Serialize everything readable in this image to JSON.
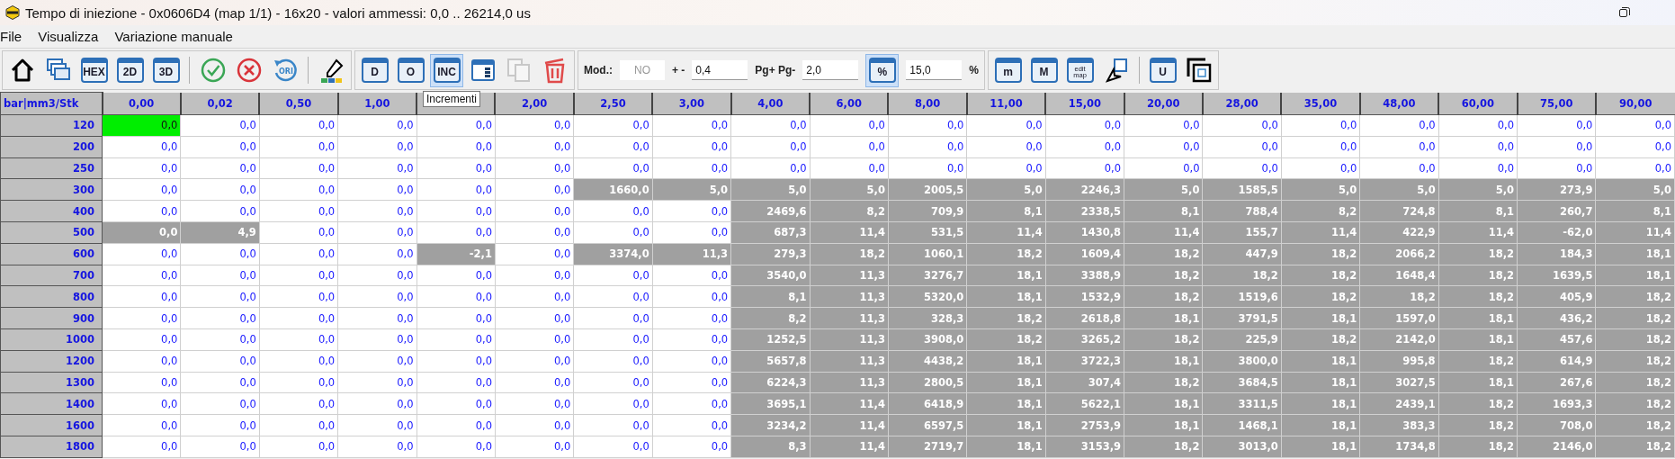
{
  "window": {
    "title": "Tempo di iniezione - 0x0606D4 (map 1/1) - 16x20 - valori ammessi: 0,0 .. 26214,0 us"
  },
  "menu": [
    {
      "label": "File"
    },
    {
      "label": "Visualizza"
    },
    {
      "label": "Variazione manuale"
    }
  ],
  "toolbar": [
    [
      {
        "kind": "home",
        "selected": false,
        "disabled": false
      },
      {
        "kind": "windows",
        "selected": false,
        "disabled": false
      },
      {
        "kind": "labeled",
        "label": "HEX",
        "selected": false,
        "disabled": false
      },
      {
        "kind": "labeled",
        "label": "2D",
        "selected": false,
        "disabled": false
      },
      {
        "kind": "labeled",
        "label": "3D",
        "selected": false,
        "disabled": false
      },
      {
        "kind": "sep"
      },
      {
        "kind": "check",
        "selected": false,
        "disabled": false
      },
      {
        "kind": "cancel",
        "selected": false,
        "disabled": false
      },
      {
        "kind": "ori",
        "label": "ORI",
        "selected": false,
        "disabled": false
      },
      {
        "kind": "sep"
      },
      {
        "kind": "picker",
        "selected": false,
        "disabled": false
      }
    ],
    [
      {
        "kind": "labeled",
        "label": "D",
        "selected": false,
        "disabled": false
      },
      {
        "kind": "labeled",
        "label": "O",
        "selected": false,
        "disabled": false
      },
      {
        "kind": "labeled",
        "label": "INC",
        "selected": true,
        "disabled": false
      },
      {
        "kind": "panel",
        "selected": false,
        "disabled": false
      },
      {
        "kind": "copy",
        "selected": false,
        "disabled": true
      },
      {
        "kind": "trash",
        "selected": false,
        "disabled": false
      }
    ],
    [
      {
        "kind": "text",
        "label": "Mod.:"
      },
      {
        "kind": "field",
        "value": "NO",
        "disabled": true
      },
      {
        "kind": "text",
        "label": "+ -"
      },
      {
        "kind": "field",
        "value": "0,4",
        "disabled": false
      },
      {
        "kind": "text",
        "label": "Pg+ Pg-"
      },
      {
        "kind": "field",
        "value": "2,0",
        "disabled": false
      },
      {
        "kind": "labeled",
        "label": "%",
        "selected": true,
        "disabled": false
      },
      {
        "kind": "field",
        "value": "15,0",
        "disabled": false
      },
      {
        "kind": "text",
        "label": "%"
      }
    ],
    [
      {
        "kind": "labeled",
        "label": "m",
        "selected": false,
        "disabled": false
      },
      {
        "kind": "labeled",
        "label": "M",
        "selected": false,
        "disabled": false
      },
      {
        "kind": "labeled",
        "label": "edit map",
        "selected": false,
        "disabled": false
      },
      {
        "kind": "cursor",
        "selected": false,
        "disabled": false
      },
      {
        "kind": "sep"
      },
      {
        "kind": "labeled",
        "label": "U",
        "selected": false,
        "disabled": false
      },
      {
        "kind": "winframe",
        "selected": false,
        "disabled": false
      }
    ]
  ],
  "tooltip": {
    "text": "Incrementi"
  },
  "table": {
    "corner": "bar|mm3/Stk",
    "columns": [
      {
        "label": "0,00"
      },
      {
        "label": "0,02"
      },
      {
        "label": "0,50"
      },
      {
        "label": "1,00"
      },
      {},
      {
        "label": "2,00"
      },
      {
        "label": "2,50"
      },
      {
        "label": "3,00"
      },
      {
        "label": "4,00"
      },
      {
        "label": "6,00"
      },
      {
        "label": "8,00"
      },
      {
        "label": "11,00"
      },
      {
        "label": "15,00"
      },
      {
        "label": "20,00"
      },
      {
        "label": "28,00"
      },
      {
        "label": "35,00"
      },
      {
        "label": "48,00"
      },
      {
        "label": "60,00"
      },
      {
        "label": "75,00"
      },
      {
        "label": "90,00"
      }
    ],
    "rows": [
      {
        "label": "120",
        "cells": [
          {
            "value": "0,0",
            "selected": false,
            "current": true
          },
          {
            "value": "0,0",
            "selected": false
          },
          {
            "value": "0,0",
            "selected": false
          },
          {
            "value": "0,0",
            "selected": false
          },
          {
            "value": "0,0",
            "selected": false
          },
          {
            "value": "0,0",
            "selected": false
          },
          {
            "value": "0,0",
            "selected": false
          },
          {
            "value": "0,0",
            "selected": false
          },
          {
            "value": "0,0",
            "selected": false
          },
          {
            "value": "0,0",
            "selected": false
          },
          {
            "value": "0,0",
            "selected": false
          },
          {
            "value": "0,0",
            "selected": false
          },
          {
            "value": "0,0",
            "selected": false
          },
          {
            "value": "0,0",
            "selected": false
          },
          {
            "value": "0,0",
            "selected": false
          },
          {
            "value": "0,0",
            "selected": false
          },
          {
            "value": "0,0",
            "selected": false
          },
          {
            "value": "0,0",
            "selected": false
          },
          {
            "value": "0,0",
            "selected": false
          },
          {
            "value": "0,0",
            "selected": false
          }
        ]
      },
      {
        "label": "200",
        "cells": [
          {
            "value": "0,0",
            "selected": false
          },
          {
            "value": "0,0",
            "selected": false
          },
          {
            "value": "0,0",
            "selected": false
          },
          {
            "value": "0,0",
            "selected": false
          },
          {
            "value": "0,0",
            "selected": false
          },
          {
            "value": "0,0",
            "selected": false
          },
          {
            "value": "0,0",
            "selected": false
          },
          {
            "value": "0,0",
            "selected": false
          },
          {
            "value": "0,0",
            "selected": false
          },
          {
            "value": "0,0",
            "selected": false
          },
          {
            "value": "0,0",
            "selected": false
          },
          {
            "value": "0,0",
            "selected": false
          },
          {
            "value": "0,0",
            "selected": false
          },
          {
            "value": "0,0",
            "selected": false
          },
          {
            "value": "0,0",
            "selected": false
          },
          {
            "value": "0,0",
            "selected": false
          },
          {
            "value": "0,0",
            "selected": false
          },
          {
            "value": "0,0",
            "selected": false
          },
          {
            "value": "0,0",
            "selected": false
          },
          {
            "value": "0,0",
            "selected": false
          }
        ]
      },
      {
        "label": "250",
        "cells": [
          {
            "value": "0,0",
            "selected": false
          },
          {
            "value": "0,0",
            "selected": false
          },
          {
            "value": "0,0",
            "selected": false
          },
          {
            "value": "0,0",
            "selected": false
          },
          {
            "value": "0,0",
            "selected": false
          },
          {
            "value": "0,0",
            "selected": false
          },
          {
            "value": "0,0",
            "selected": false
          },
          {
            "value": "0,0",
            "selected": false
          },
          {
            "value": "0,0",
            "selected": false
          },
          {
            "value": "0,0",
            "selected": false
          },
          {
            "value": "0,0",
            "selected": false
          },
          {
            "value": "0,0",
            "selected": false
          },
          {
            "value": "0,0",
            "selected": false
          },
          {
            "value": "0,0",
            "selected": false
          },
          {
            "value": "0,0",
            "selected": false
          },
          {
            "value": "0,0",
            "selected": false
          },
          {
            "value": "0,0",
            "selected": false
          },
          {
            "value": "0,0",
            "selected": false
          },
          {
            "value": "0,0",
            "selected": false
          },
          {
            "value": "0,0",
            "selected": false
          }
        ]
      },
      {
        "label": "300",
        "cells": [
          {
            "value": "0,0",
            "selected": false
          },
          {
            "value": "0,0",
            "selected": false
          },
          {
            "value": "0,0",
            "selected": false
          },
          {
            "value": "0,0",
            "selected": false
          },
          {
            "value": "0,0",
            "selected": false
          },
          {
            "value": "0,0",
            "selected": false
          },
          {
            "value": "1660,0",
            "selected": true
          },
          {
            "value": "5,0",
            "selected": true
          },
          {
            "value": "5,0",
            "selected": true
          },
          {
            "value": "5,0",
            "selected": true
          },
          {
            "value": "2005,5",
            "selected": true
          },
          {
            "value": "5,0",
            "selected": true
          },
          {
            "value": "2246,3",
            "selected": true
          },
          {
            "value": "5,0",
            "selected": true
          },
          {
            "value": "1585,5",
            "selected": true
          },
          {
            "value": "5,0",
            "selected": true
          },
          {
            "value": "5,0",
            "selected": true
          },
          {
            "value": "5,0",
            "selected": true
          },
          {
            "value": "273,9",
            "selected": true
          },
          {
            "value": "5,0",
            "selected": true
          }
        ]
      },
      {
        "label": "400",
        "cells": [
          {
            "value": "0,0",
            "selected": false
          },
          {
            "value": "0,0",
            "selected": false
          },
          {
            "value": "0,0",
            "selected": false
          },
          {
            "value": "0,0",
            "selected": false
          },
          {
            "value": "0,0",
            "selected": false
          },
          {
            "value": "0,0",
            "selected": false
          },
          {
            "value": "0,0",
            "selected": false
          },
          {
            "value": "0,0",
            "selected": false
          },
          {
            "value": "2469,6",
            "selected": true
          },
          {
            "value": "8,2",
            "selected": true
          },
          {
            "value": "709,9",
            "selected": true
          },
          {
            "value": "8,1",
            "selected": true
          },
          {
            "value": "2338,5",
            "selected": true
          },
          {
            "value": "8,1",
            "selected": true
          },
          {
            "value": "788,4",
            "selected": true
          },
          {
            "value": "8,2",
            "selected": true
          },
          {
            "value": "724,8",
            "selected": true
          },
          {
            "value": "8,1",
            "selected": true
          },
          {
            "value": "260,7",
            "selected": true
          },
          {
            "value": "8,1",
            "selected": true
          }
        ]
      },
      {
        "label": "500",
        "cells": [
          {
            "value": "0,0",
            "selected": true
          },
          {
            "value": "4,9",
            "selected": true
          },
          {
            "value": "0,0",
            "selected": false
          },
          {
            "value": "0,0",
            "selected": false
          },
          {
            "value": "0,0",
            "selected": false
          },
          {
            "value": "0,0",
            "selected": false
          },
          {
            "value": "0,0",
            "selected": false
          },
          {
            "value": "0,0",
            "selected": false
          },
          {
            "value": "687,3",
            "selected": true
          },
          {
            "value": "11,4",
            "selected": true
          },
          {
            "value": "531,5",
            "selected": true
          },
          {
            "value": "11,4",
            "selected": true
          },
          {
            "value": "1430,8",
            "selected": true
          },
          {
            "value": "11,4",
            "selected": true
          },
          {
            "value": "155,7",
            "selected": true
          },
          {
            "value": "11,4",
            "selected": true
          },
          {
            "value": "422,9",
            "selected": true
          },
          {
            "value": "11,4",
            "selected": true
          },
          {
            "value": "-62,0",
            "selected": true
          },
          {
            "value": "11,4",
            "selected": true
          }
        ]
      },
      {
        "label": "600",
        "cells": [
          {
            "value": "0,0",
            "selected": false
          },
          {
            "value": "0,0",
            "selected": false
          },
          {
            "value": "0,0",
            "selected": false
          },
          {
            "value": "0,0",
            "selected": false
          },
          {
            "value": "-2,1",
            "selected": true
          },
          {
            "value": "0,0",
            "selected": false
          },
          {
            "value": "3374,0",
            "selected": true
          },
          {
            "value": "11,3",
            "selected": true
          },
          {
            "value": "279,3",
            "selected": true
          },
          {
            "value": "18,2",
            "selected": true
          },
          {
            "value": "1060,1",
            "selected": true
          },
          {
            "value": "18,2",
            "selected": true
          },
          {
            "value": "1609,4",
            "selected": true
          },
          {
            "value": "18,2",
            "selected": true
          },
          {
            "value": "447,9",
            "selected": true
          },
          {
            "value": "18,2",
            "selected": true
          },
          {
            "value": "2066,2",
            "selected": true
          },
          {
            "value": "18,2",
            "selected": true
          },
          {
            "value": "184,3",
            "selected": true
          },
          {
            "value": "18,1",
            "selected": true
          }
        ]
      },
      {
        "label": "700",
        "cells": [
          {
            "value": "0,0",
            "selected": false
          },
          {
            "value": "0,0",
            "selected": false
          },
          {
            "value": "0,0",
            "selected": false
          },
          {
            "value": "0,0",
            "selected": false
          },
          {
            "value": "0,0",
            "selected": false
          },
          {
            "value": "0,0",
            "selected": false
          },
          {
            "value": "0,0",
            "selected": false
          },
          {
            "value": "0,0",
            "selected": false
          },
          {
            "value": "3540,0",
            "selected": true
          },
          {
            "value": "11,3",
            "selected": true
          },
          {
            "value": "3276,7",
            "selected": true
          },
          {
            "value": "18,1",
            "selected": true
          },
          {
            "value": "3388,9",
            "selected": true
          },
          {
            "value": "18,2",
            "selected": true
          },
          {
            "value": "18,2",
            "selected": true
          },
          {
            "value": "18,2",
            "selected": true
          },
          {
            "value": "1648,4",
            "selected": true
          },
          {
            "value": "18,2",
            "selected": true
          },
          {
            "value": "1639,5",
            "selected": true
          },
          {
            "value": "18,1",
            "selected": true
          }
        ]
      },
      {
        "label": "800",
        "cells": [
          {
            "value": "0,0",
            "selected": false
          },
          {
            "value": "0,0",
            "selected": false
          },
          {
            "value": "0,0",
            "selected": false
          },
          {
            "value": "0,0",
            "selected": false
          },
          {
            "value": "0,0",
            "selected": false
          },
          {
            "value": "0,0",
            "selected": false
          },
          {
            "value": "0,0",
            "selected": false
          },
          {
            "value": "0,0",
            "selected": false
          },
          {
            "value": "8,1",
            "selected": true
          },
          {
            "value": "11,3",
            "selected": true
          },
          {
            "value": "5320,0",
            "selected": true
          },
          {
            "value": "18,1",
            "selected": true
          },
          {
            "value": "1532,9",
            "selected": true
          },
          {
            "value": "18,2",
            "selected": true
          },
          {
            "value": "1519,6",
            "selected": true
          },
          {
            "value": "18,2",
            "selected": true
          },
          {
            "value": "18,2",
            "selected": true
          },
          {
            "value": "18,2",
            "selected": true
          },
          {
            "value": "405,9",
            "selected": true
          },
          {
            "value": "18,2",
            "selected": true
          }
        ]
      },
      {
        "label": "900",
        "cells": [
          {
            "value": "0,0",
            "selected": false
          },
          {
            "value": "0,0",
            "selected": false
          },
          {
            "value": "0,0",
            "selected": false
          },
          {
            "value": "0,0",
            "selected": false
          },
          {
            "value": "0,0",
            "selected": false
          },
          {
            "value": "0,0",
            "selected": false
          },
          {
            "value": "0,0",
            "selected": false
          },
          {
            "value": "0,0",
            "selected": false
          },
          {
            "value": "8,2",
            "selected": true
          },
          {
            "value": "11,3",
            "selected": true
          },
          {
            "value": "328,3",
            "selected": true
          },
          {
            "value": "18,2",
            "selected": true
          },
          {
            "value": "2618,8",
            "selected": true
          },
          {
            "value": "18,1",
            "selected": true
          },
          {
            "value": "3791,5",
            "selected": true
          },
          {
            "value": "18,1",
            "selected": true
          },
          {
            "value": "1597,0",
            "selected": true
          },
          {
            "value": "18,1",
            "selected": true
          },
          {
            "value": "436,2",
            "selected": true
          },
          {
            "value": "18,2",
            "selected": true
          }
        ]
      },
      {
        "label": "1000",
        "cells": [
          {
            "value": "0,0",
            "selected": false
          },
          {
            "value": "0,0",
            "selected": false
          },
          {
            "value": "0,0",
            "selected": false
          },
          {
            "value": "0,0",
            "selected": false
          },
          {
            "value": "0,0",
            "selected": false
          },
          {
            "value": "0,0",
            "selected": false
          },
          {
            "value": "0,0",
            "selected": false
          },
          {
            "value": "0,0",
            "selected": false
          },
          {
            "value": "1252,5",
            "selected": true
          },
          {
            "value": "11,3",
            "selected": true
          },
          {
            "value": "3908,0",
            "selected": true
          },
          {
            "value": "18,2",
            "selected": true
          },
          {
            "value": "3265,2",
            "selected": true
          },
          {
            "value": "18,2",
            "selected": true
          },
          {
            "value": "225,9",
            "selected": true
          },
          {
            "value": "18,2",
            "selected": true
          },
          {
            "value": "2142,0",
            "selected": true
          },
          {
            "value": "18,1",
            "selected": true
          },
          {
            "value": "457,6",
            "selected": true
          },
          {
            "value": "18,2",
            "selected": true
          }
        ]
      },
      {
        "label": "1200",
        "cells": [
          {
            "value": "0,0",
            "selected": false
          },
          {
            "value": "0,0",
            "selected": false
          },
          {
            "value": "0,0",
            "selected": false
          },
          {
            "value": "0,0",
            "selected": false
          },
          {
            "value": "0,0",
            "selected": false
          },
          {
            "value": "0,0",
            "selected": false
          },
          {
            "value": "0,0",
            "selected": false
          },
          {
            "value": "0,0",
            "selected": false
          },
          {
            "value": "5657,8",
            "selected": true
          },
          {
            "value": "11,3",
            "selected": true
          },
          {
            "value": "4438,2",
            "selected": true
          },
          {
            "value": "18,1",
            "selected": true
          },
          {
            "value": "3722,3",
            "selected": true
          },
          {
            "value": "18,1",
            "selected": true
          },
          {
            "value": "3800,0",
            "selected": true
          },
          {
            "value": "18,1",
            "selected": true
          },
          {
            "value": "995,8",
            "selected": true
          },
          {
            "value": "18,2",
            "selected": true
          },
          {
            "value": "614,9",
            "selected": true
          },
          {
            "value": "18,2",
            "selected": true
          }
        ]
      },
      {
        "label": "1300",
        "cells": [
          {
            "value": "0,0",
            "selected": false
          },
          {
            "value": "0,0",
            "selected": false
          },
          {
            "value": "0,0",
            "selected": false
          },
          {
            "value": "0,0",
            "selected": false
          },
          {
            "value": "0,0",
            "selected": false
          },
          {
            "value": "0,0",
            "selected": false
          },
          {
            "value": "0,0",
            "selected": false
          },
          {
            "value": "0,0",
            "selected": false
          },
          {
            "value": "6224,3",
            "selected": true
          },
          {
            "value": "11,3",
            "selected": true
          },
          {
            "value": "2800,5",
            "selected": true
          },
          {
            "value": "18,1",
            "selected": true
          },
          {
            "value": "307,4",
            "selected": true
          },
          {
            "value": "18,2",
            "selected": true
          },
          {
            "value": "3684,5",
            "selected": true
          },
          {
            "value": "18,1",
            "selected": true
          },
          {
            "value": "3027,5",
            "selected": true
          },
          {
            "value": "18,1",
            "selected": true
          },
          {
            "value": "267,6",
            "selected": true
          },
          {
            "value": "18,2",
            "selected": true
          }
        ]
      },
      {
        "label": "1400",
        "cells": [
          {
            "value": "0,0",
            "selected": false
          },
          {
            "value": "0,0",
            "selected": false
          },
          {
            "value": "0,0",
            "selected": false
          },
          {
            "value": "0,0",
            "selected": false
          },
          {
            "value": "0,0",
            "selected": false
          },
          {
            "value": "0,0",
            "selected": false
          },
          {
            "value": "0,0",
            "selected": false
          },
          {
            "value": "0,0",
            "selected": false
          },
          {
            "value": "3695,1",
            "selected": true
          },
          {
            "value": "11,4",
            "selected": true
          },
          {
            "value": "6418,9",
            "selected": true
          },
          {
            "value": "18,1",
            "selected": true
          },
          {
            "value": "5622,1",
            "selected": true
          },
          {
            "value": "18,1",
            "selected": true
          },
          {
            "value": "3311,5",
            "selected": true
          },
          {
            "value": "18,1",
            "selected": true
          },
          {
            "value": "2439,1",
            "selected": true
          },
          {
            "value": "18,2",
            "selected": true
          },
          {
            "value": "1693,3",
            "selected": true
          },
          {
            "value": "18,2",
            "selected": true
          }
        ]
      },
      {
        "label": "1600",
        "cells": [
          {
            "value": "0,0",
            "selected": false
          },
          {
            "value": "0,0",
            "selected": false
          },
          {
            "value": "0,0",
            "selected": false
          },
          {
            "value": "0,0",
            "selected": false
          },
          {
            "value": "0,0",
            "selected": false
          },
          {
            "value": "0,0",
            "selected": false
          },
          {
            "value": "0,0",
            "selected": false
          },
          {
            "value": "0,0",
            "selected": false
          },
          {
            "value": "3234,2",
            "selected": true
          },
          {
            "value": "11,4",
            "selected": true
          },
          {
            "value": "6597,5",
            "selected": true
          },
          {
            "value": "18,1",
            "selected": true
          },
          {
            "value": "2753,9",
            "selected": true
          },
          {
            "value": "18,1",
            "selected": true
          },
          {
            "value": "1468,1",
            "selected": true
          },
          {
            "value": "18,1",
            "selected": true
          },
          {
            "value": "383,3",
            "selected": true
          },
          {
            "value": "18,2",
            "selected": true
          },
          {
            "value": "708,0",
            "selected": true
          },
          {
            "value": "18,2",
            "selected": true
          }
        ]
      },
      {
        "label": "1800",
        "cells": [
          {
            "value": "0,0",
            "selected": false
          },
          {
            "value": "0,0",
            "selected": false
          },
          {
            "value": "0,0",
            "selected": false
          },
          {
            "value": "0,0",
            "selected": false
          },
          {
            "value": "0,0",
            "selected": false
          },
          {
            "value": "0,0",
            "selected": false
          },
          {
            "value": "0,0",
            "selected": false
          },
          {
            "value": "0,0",
            "selected": false
          },
          {
            "value": "8,3",
            "selected": true
          },
          {
            "value": "11,4",
            "selected": true
          },
          {
            "value": "2719,7",
            "selected": true
          },
          {
            "value": "18,1",
            "selected": true
          },
          {
            "value": "3153,9",
            "selected": true
          },
          {
            "value": "18,2",
            "selected": true
          },
          {
            "value": "3013,0",
            "selected": true
          },
          {
            "value": "18,1",
            "selected": true
          },
          {
            "value": "1734,8",
            "selected": true
          },
          {
            "value": "18,2",
            "selected": true
          },
          {
            "value": "2146,0",
            "selected": true
          },
          {
            "value": "18,2",
            "selected": true
          }
        ]
      }
    ]
  }
}
